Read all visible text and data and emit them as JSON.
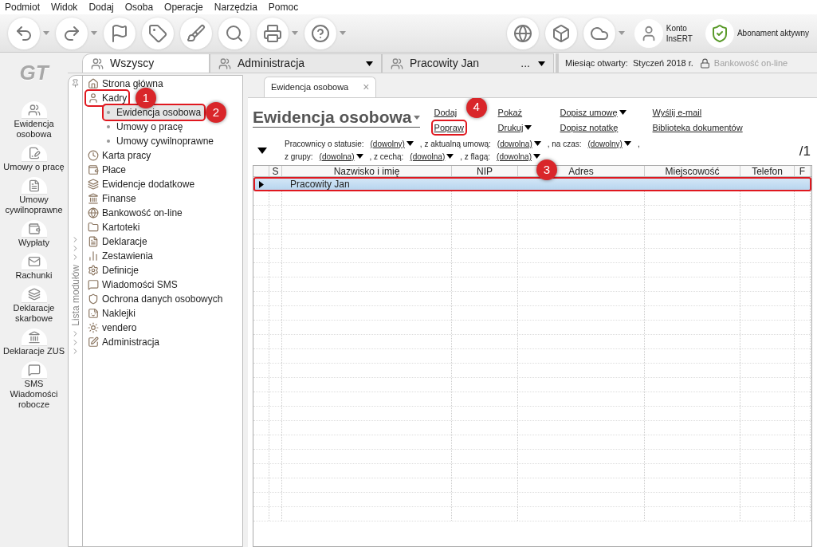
{
  "menu": [
    "Podmiot",
    "Widok",
    "Dodaj",
    "Osoba",
    "Operacje",
    "Narzędzia",
    "Pomoc"
  ],
  "toolbar": {
    "account": [
      "Konto",
      "InsERT"
    ],
    "subscription": "Abonament aktywny"
  },
  "logo": "GT",
  "tabs": [
    {
      "label": "Wszyscy",
      "selected": true
    },
    {
      "label": "Administracja",
      "selected": false
    },
    {
      "label": "Pracowity Jan",
      "selected": false,
      "more": "..."
    }
  ],
  "status": {
    "month_label": "Miesiąc otwarty:",
    "month": "Styczeń 2018 r.",
    "banking": "Bankowość on-line",
    "banking_disabled": true
  },
  "shortcuts": [
    "Ewidencja osobowa",
    "Umowy o pracę",
    "Umowy cywilnoprawne",
    "Wypłaty",
    "Rachunki",
    "Deklaracje skarbowe",
    "Deklaracje ZUS",
    "SMS Wiadomości robocze"
  ],
  "modules": {
    "title": "Lista modułów",
    "items": [
      {
        "label": "Strona główna",
        "highlighted": false
      },
      {
        "label": "Kadry",
        "highlighted": true,
        "callout": "1",
        "children": [
          {
            "label": "Ewidencja osobowa",
            "selected": true,
            "highlighted": true,
            "callout": "2"
          },
          {
            "label": "Umowy o pracę",
            "selected": false,
            "highlighted": false
          },
          {
            "label": "Umowy cywilnoprawne",
            "selected": false,
            "highlighted": false
          }
        ]
      },
      {
        "label": "Karta pracy",
        "highlighted": false
      },
      {
        "label": "Płace",
        "highlighted": false
      },
      {
        "label": "Ewidencje dodatkowe",
        "highlighted": false
      },
      {
        "label": "Finanse",
        "highlighted": false
      },
      {
        "label": "Bankowość on-line",
        "highlighted": false
      },
      {
        "label": "Kartoteki",
        "highlighted": false
      },
      {
        "label": "Deklaracje",
        "highlighted": false
      },
      {
        "label": "Zestawienia",
        "highlighted": false
      },
      {
        "label": "Definicje",
        "highlighted": false
      },
      {
        "label": "Wiadomości SMS",
        "highlighted": false
      },
      {
        "label": "Ochrona danych osobowych",
        "highlighted": false
      },
      {
        "label": "Naklejki",
        "highlighted": false
      },
      {
        "label": "vendero",
        "highlighted": false
      },
      {
        "label": "Administracja",
        "highlighted": false
      }
    ]
  },
  "document_tab": {
    "label": "Ewidencja osobowa",
    "close": "×"
  },
  "title": "Ewidencja osobowa",
  "actions": [
    [
      {
        "label": "Dodaj",
        "dropdown": false,
        "highlighted": false
      },
      {
        "label": "Popraw",
        "dropdown": false,
        "highlighted": true,
        "callout": "4"
      }
    ],
    [
      {
        "label": "Pokaż",
        "dropdown": false,
        "highlighted": false
      },
      {
        "label": "Drukuj",
        "dropdown": true,
        "highlighted": false
      }
    ],
    [
      {
        "label": "Dopisz umowę",
        "dropdown": true,
        "highlighted": false
      },
      {
        "label": "Dopisz notatkę",
        "dropdown": false,
        "highlighted": false
      }
    ],
    [
      {
        "label": "Wyślij e-mail",
        "dropdown": false,
        "highlighted": false
      },
      {
        "label": "Biblioteka dokumentów",
        "dropdown": false,
        "highlighted": false
      }
    ]
  ],
  "filters": [
    [
      {
        "label": "Pracownicy o statusie:",
        "value": "(dowolny)"
      },
      {
        "label": ", z aktualną umową:",
        "value": "(dowolna)"
      },
      {
        "label": ", na czas:",
        "value": "(dowolny)"
      },
      {
        "label": ","
      }
    ],
    [
      {
        "label": "z grupy:",
        "value": "(dowolna)"
      },
      {
        "label": ", z cechą:",
        "value": "(dowolna)"
      },
      {
        "label": ", z flagą:",
        "value": "(dowolna)"
      }
    ]
  ],
  "page_count": "/1",
  "table": {
    "columns": [
      "S",
      "Nazwisko i imię",
      "NIP",
      "Adres",
      "Miejscowość",
      "Telefon",
      "F"
    ],
    "rows": [
      {
        "name": "Pracowity Jan",
        "selected": true,
        "highlighted": true,
        "callout": "3"
      }
    ]
  }
}
